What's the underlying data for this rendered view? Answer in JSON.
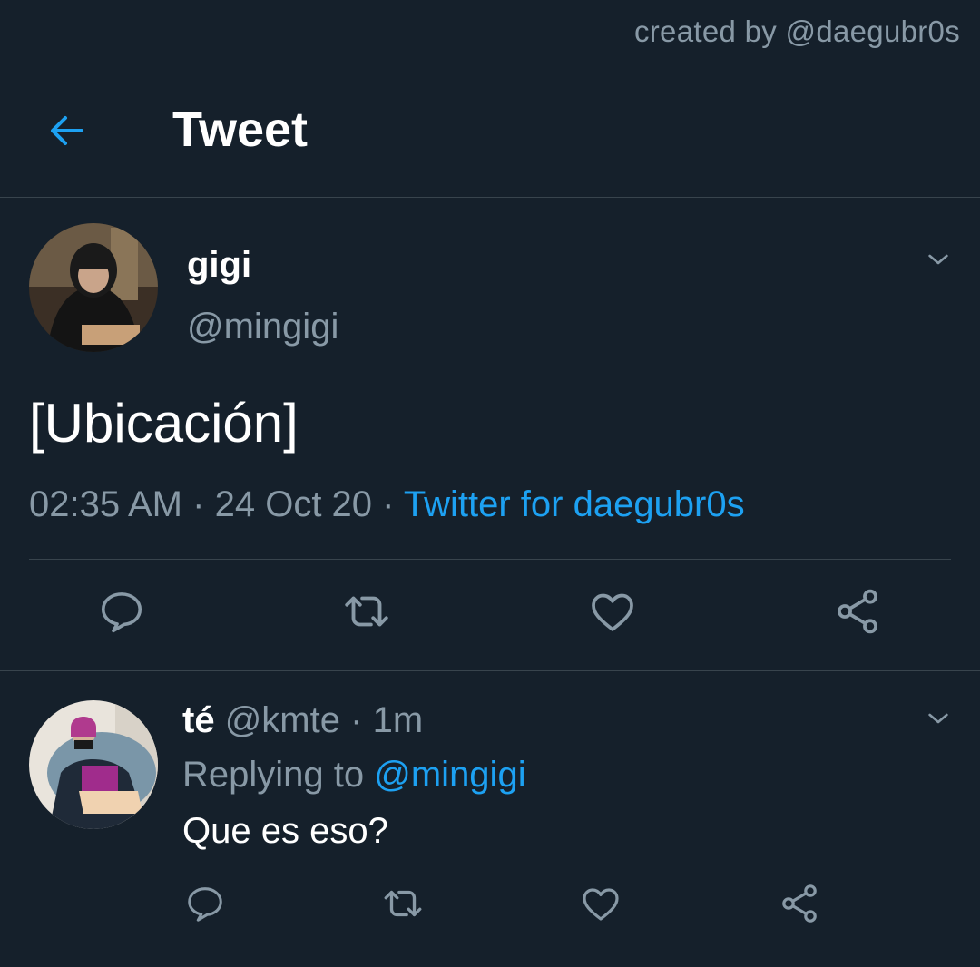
{
  "credit": {
    "text": "created by @daegubr0s"
  },
  "header": {
    "title": "Tweet",
    "back_icon": "arrow-left-icon"
  },
  "colors": {
    "background": "#15202b",
    "accent": "#1da1f2",
    "secondary_text": "#8899a6",
    "divider": "#38444d"
  },
  "main_tweet": {
    "display_name": "gigi",
    "handle": "@mingigi",
    "text": "[Ubicación]",
    "time": "02:35 AM",
    "date": "24 Oct 20",
    "separator": "·",
    "source": "Twitter for daegubr0s",
    "actions": [
      "reply-icon",
      "retweet-icon",
      "like-icon",
      "share-icon"
    ]
  },
  "reply": {
    "display_name": "té",
    "handle": "@kmte",
    "separator": "·",
    "time": "1m",
    "replying_prefix": "Replying to",
    "replying_to": "@mingigi",
    "text": "Que es eso?",
    "actions": [
      "reply-icon",
      "retweet-icon",
      "like-icon",
      "share-icon"
    ]
  }
}
